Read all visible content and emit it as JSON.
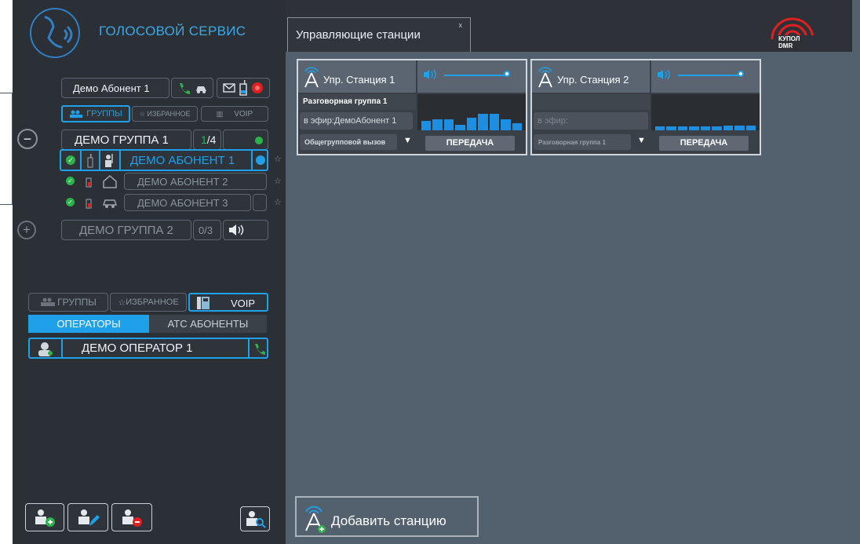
{
  "app": {
    "title": "ГОЛОСОВОЙ СЕРВИС"
  },
  "user": {
    "name": "Демо Абонент 1"
  },
  "top_tabs": [
    "ГРУППЫ",
    "ИЗБРАННОЕ",
    "VOIP"
  ],
  "groups": [
    {
      "name": "ДЕМО ГРУППА 1",
      "count_active": "1",
      "count_total": "/4",
      "toggle": "−"
    },
    {
      "name": "ДЕМО ГРУППА 2",
      "count": "0/3",
      "toggle": "+"
    }
  ],
  "subscribers": [
    {
      "name": "ДЕМО АБОНЕНТ 1"
    },
    {
      "name": "ДЕМО АБОНЕНТ 2"
    },
    {
      "name": "ДЕМО АБОНЕНТ 3"
    }
  ],
  "bottom_tabs": [
    "ГРУППЫ",
    "ИЗБРАННОЕ",
    "VOIP"
  ],
  "sub_tabs": [
    "ОПЕРАТОРЫ",
    "АТС АБОНЕНТЫ"
  ],
  "operators": [
    {
      "name": "ДЕМО ОПЕРАТОР 1"
    }
  ],
  "main_tab": {
    "label": "Управляющие станции",
    "close": "x"
  },
  "logo": {
    "text": "КУПОЛ DMR"
  },
  "stations": [
    {
      "title": "Упр. Станция 1",
      "group": "Разговорная группа 1",
      "on_air": "в эфир:ДемоАбонент 1",
      "call_type": "Общегрупповой вызов",
      "transmit": "ПЕРЕДАЧА",
      "levels": [
        0.25,
        0.3,
        0.3,
        0.15,
        0.35,
        0.45,
        0.45,
        0.3,
        0.2
      ]
    },
    {
      "title": "Упр. Станция 2",
      "group": "",
      "on_air": "в эфир:",
      "call_type": "Разговорная группа 1",
      "transmit": "ПЕРЕДАЧА",
      "levels": [
        0.1,
        0.1,
        0.1,
        0.1,
        0.1,
        0.1,
        0.12,
        0.12,
        0.12
      ]
    }
  ],
  "add_station": {
    "label": "Добавить станцию"
  },
  "colors": {
    "accent": "#1fa0e8",
    "online": "#2bb34a",
    "alarm": "#e02020"
  }
}
